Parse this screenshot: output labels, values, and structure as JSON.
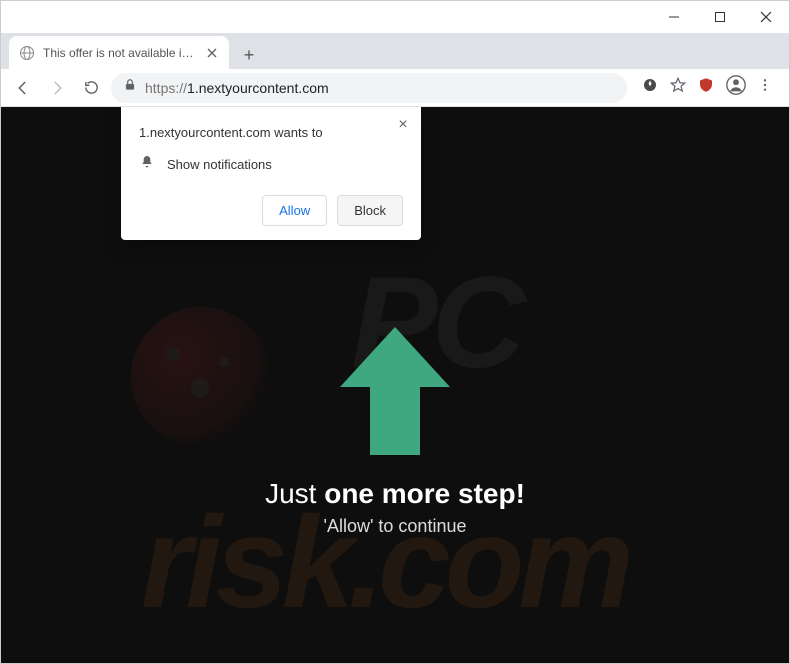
{
  "window": {
    "tab_title": "This offer is not available in your",
    "new_tab_label": "+"
  },
  "toolbar": {
    "url_protocol": "https://",
    "url_host": "1.nextyourcontent.com"
  },
  "permission_prompt": {
    "site_wants_to": "1.nextyourcontent.com wants to",
    "permission_label": "Show notifications",
    "allow_label": "Allow",
    "block_label": "Block",
    "close_label": "×"
  },
  "page": {
    "headline_plain": "Just ",
    "headline_bold": "one more step!",
    "subline": "'Allow' to continue"
  },
  "watermark": {
    "top_text": "PC",
    "bottom_text": "risk.com"
  }
}
